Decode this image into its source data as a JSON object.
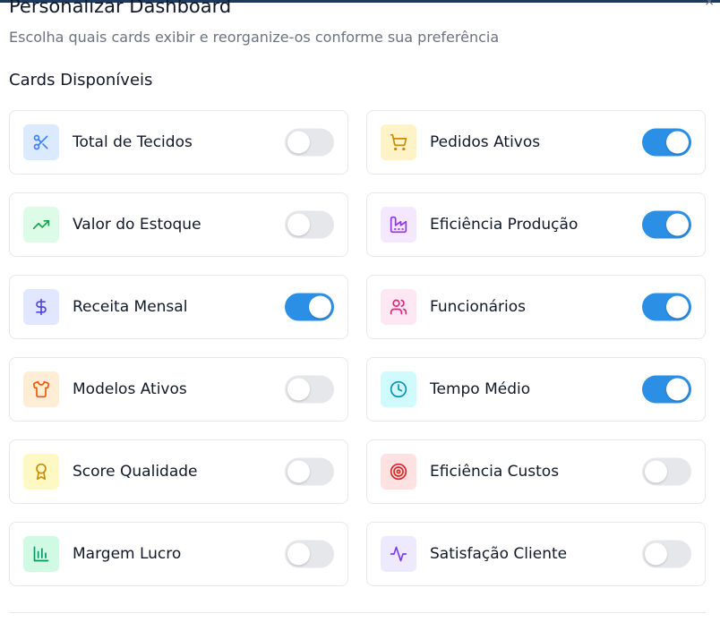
{
  "dialog": {
    "title": "Personalizar Dashboard",
    "subtitle": "Escolha quais cards exibir e reorganize-os conforme sua preferência",
    "section_title": "Cards Disponíveis",
    "close_glyph": "×"
  },
  "cards": [
    {
      "label": "Total de Tecidos",
      "icon": "scissors-icon",
      "icon_color": "#3b82f6",
      "bg": "#dbeafe",
      "enabled": false
    },
    {
      "label": "Pedidos Ativos",
      "icon": "shopping-cart-icon",
      "icon_color": "#ca8a04",
      "bg": "#fef3c7",
      "enabled": true
    },
    {
      "label": "Valor do Estoque",
      "icon": "trending-up-icon",
      "icon_color": "#16a34a",
      "bg": "#dcfce7",
      "enabled": false
    },
    {
      "label": "Eficiência Produção",
      "icon": "factory-icon",
      "icon_color": "#9333ea",
      "bg": "#f3e8ff",
      "enabled": true
    },
    {
      "label": "Receita Mensal",
      "icon": "dollar-sign-icon",
      "icon_color": "#4f46e5",
      "bg": "#e0e7ff",
      "enabled": true
    },
    {
      "label": "Funcionários",
      "icon": "users-icon",
      "icon_color": "#db2777",
      "bg": "#fce7f3",
      "enabled": true
    },
    {
      "label": "Modelos Ativos",
      "icon": "shirt-icon",
      "icon_color": "#ea580c",
      "bg": "#ffedd5",
      "enabled": false
    },
    {
      "label": "Tempo Médio",
      "icon": "clock-icon",
      "icon_color": "#0891b2",
      "bg": "#cffafe",
      "enabled": true
    },
    {
      "label": "Score Qualidade",
      "icon": "award-icon",
      "icon_color": "#ca8a04",
      "bg": "#fef9c3",
      "enabled": false
    },
    {
      "label": "Eficiência Custos",
      "icon": "target-icon",
      "icon_color": "#dc2626",
      "bg": "#fee2e2",
      "enabled": false
    },
    {
      "label": "Margem Lucro",
      "icon": "bar-chart-icon",
      "icon_color": "#059669",
      "bg": "#d1fae5",
      "enabled": false
    },
    {
      "label": "Satisfação Cliente",
      "icon": "activity-icon",
      "icon_color": "#7c3aed",
      "bg": "#ede9fe",
      "enabled": false
    }
  ],
  "colors": {
    "toggle_on": "#2b8fe6",
    "toggle_off": "#e5e7eb"
  }
}
